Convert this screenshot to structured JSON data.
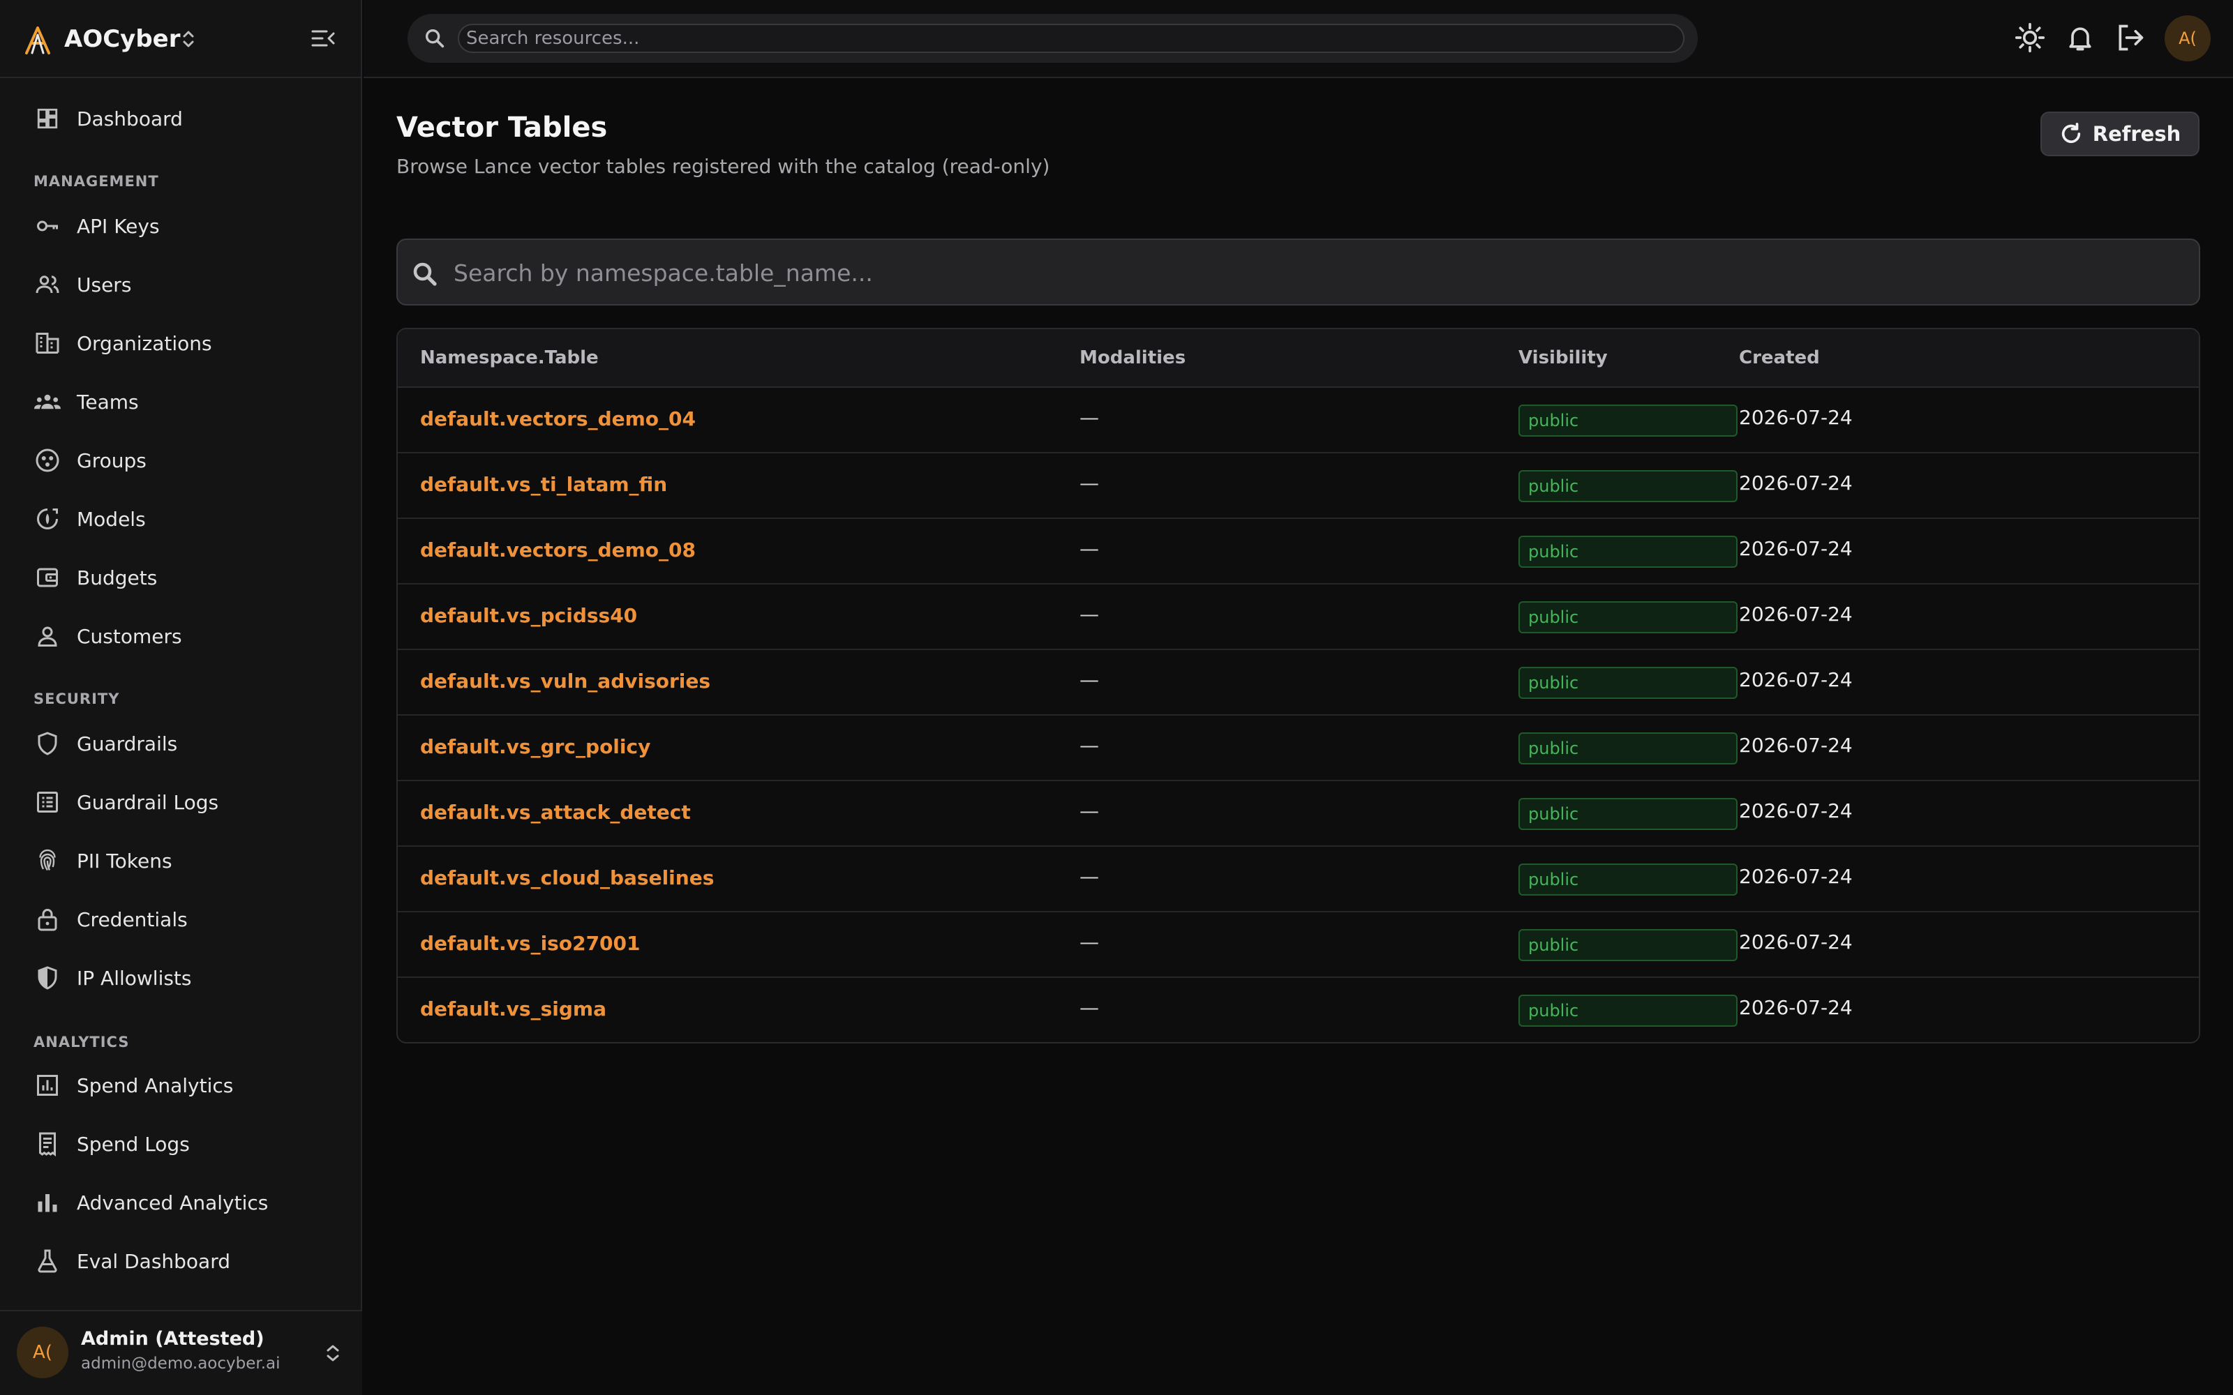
{
  "sidebar": {
    "brand_name": "AOCyber",
    "nav_top": [
      {
        "label": "Dashboard",
        "icon": "dashboard-icon"
      }
    ],
    "management_header": "MANAGEMENT",
    "management": [
      {
        "label": "API Keys",
        "icon": "key-icon"
      },
      {
        "label": "Users",
        "icon": "users-icon"
      },
      {
        "label": "Organizations",
        "icon": "building-icon"
      },
      {
        "label": "Teams",
        "icon": "team-icon"
      },
      {
        "label": "Groups",
        "icon": "groups-icon"
      },
      {
        "label": "Models",
        "icon": "models-icon"
      },
      {
        "label": "Budgets",
        "icon": "wallet-icon"
      },
      {
        "label": "Customers",
        "icon": "person-icon"
      }
    ],
    "security_header": "SECURITY",
    "security": [
      {
        "label": "Guardrails",
        "icon": "shield-icon"
      },
      {
        "label": "Guardrail Logs",
        "icon": "list-log-icon"
      },
      {
        "label": "PII Tokens",
        "icon": "fingerprint-icon"
      },
      {
        "label": "Credentials",
        "icon": "lock-icon"
      },
      {
        "label": "IP Allowlists",
        "icon": "shield-half-icon"
      }
    ],
    "analytics_header": "ANALYTICS",
    "analytics": [
      {
        "label": "Spend Analytics",
        "icon": "chart-box-icon"
      },
      {
        "label": "Spend Logs",
        "icon": "receipt-icon"
      },
      {
        "label": "Advanced Analytics",
        "icon": "bar-chart-icon"
      },
      {
        "label": "Eval Dashboard",
        "icon": "flask-icon"
      }
    ],
    "user": {
      "initials": "A(",
      "name": "Admin (Attested)",
      "email": "admin@demo.aocyber.ai"
    }
  },
  "topbar": {
    "search_placeholder": "Search resources...",
    "avatar_initials": "A("
  },
  "main": {
    "title": "Vector Tables",
    "subtitle": "Browse Lance vector tables registered with the catalog (read-only)",
    "refresh_label": "Refresh",
    "search_placeholder": "Search by namespace.table_name...",
    "columns": [
      "Namespace.Table",
      "Modalities",
      "Visibility",
      "Created"
    ],
    "rows": [
      {
        "name": "default.vectors_demo_04",
        "modalities": "—",
        "visibility": "public",
        "created": "2026-07-24"
      },
      {
        "name": "default.vs_ti_latam_fin",
        "modalities": "—",
        "visibility": "public",
        "created": "2026-07-24"
      },
      {
        "name": "default.vectors_demo_08",
        "modalities": "—",
        "visibility": "public",
        "created": "2026-07-24"
      },
      {
        "name": "default.vs_pcidss40",
        "modalities": "—",
        "visibility": "public",
        "created": "2026-07-24"
      },
      {
        "name": "default.vs_vuln_advisories",
        "modalities": "—",
        "visibility": "public",
        "created": "2026-07-24"
      },
      {
        "name": "default.vs_grc_policy",
        "modalities": "—",
        "visibility": "public",
        "created": "2026-07-24"
      },
      {
        "name": "default.vs_attack_detect",
        "modalities": "—",
        "visibility": "public",
        "created": "2026-07-24"
      },
      {
        "name": "default.vs_cloud_baselines",
        "modalities": "—",
        "visibility": "public",
        "created": "2026-07-24"
      },
      {
        "name": "default.vs_iso27001",
        "modalities": "—",
        "visibility": "public",
        "created": "2026-07-24"
      },
      {
        "name": "default.vs_sigma",
        "modalities": "—",
        "visibility": "public",
        "created": "2026-07-24"
      }
    ]
  },
  "colors": {
    "accent": "#f0923a",
    "badge_green": "#45b45a",
    "background": "#0b0b0b",
    "sidebar": "#141415"
  }
}
